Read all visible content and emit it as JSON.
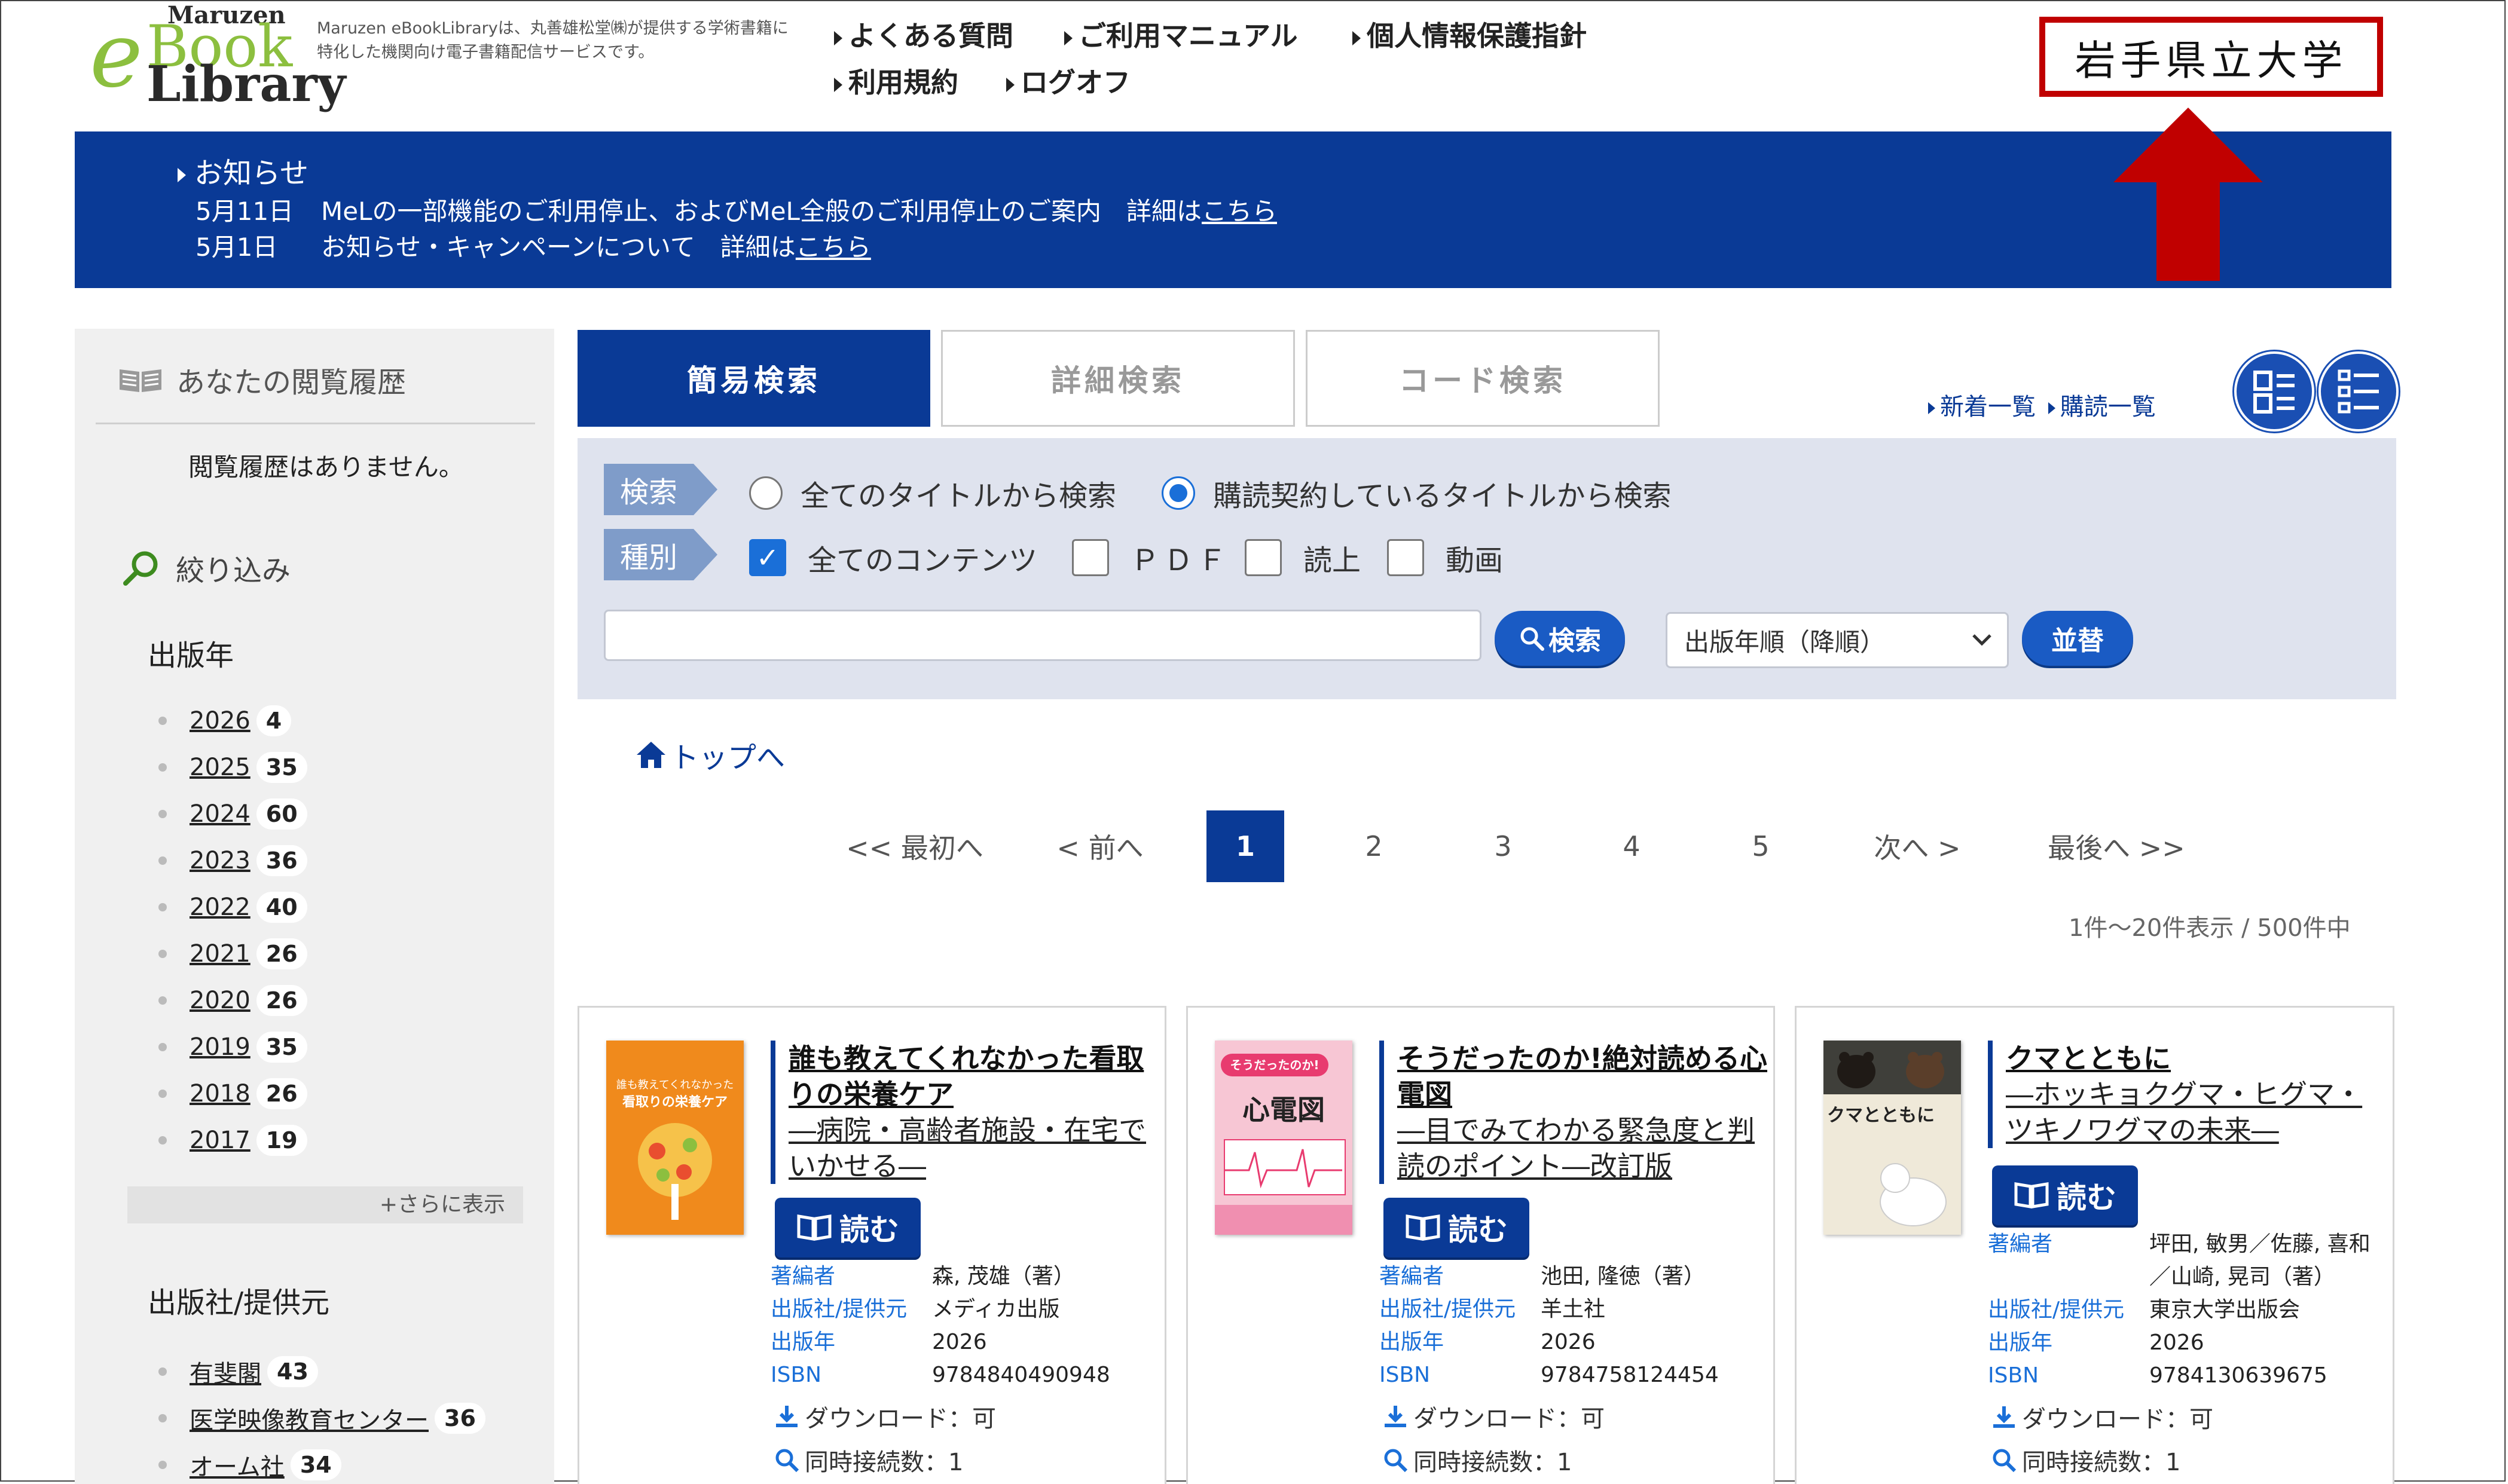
{
  "header": {
    "logo_maruzen": "Maruzen",
    "logo_e": "e",
    "logo_book": "Book",
    "logo_library": "Library",
    "tagline": "Maruzen eBookLibraryは、丸善雄松堂㈱が提供する学術書籍に特化した機関向け電子書籍配信サービスです。",
    "nav": [
      "よくある質問",
      "ご利用マニュアル",
      "個人情報保護指針",
      "利用規約",
      "ログオフ"
    ],
    "university": "岩手県立大学"
  },
  "notice": {
    "heading": "お知らせ",
    "items": [
      {
        "date": "5月11日",
        "text": "MeLの一部機能のご利用停止、およびMeL全般のご利用停止のご案内　詳細は",
        "link": "こちら"
      },
      {
        "date": "5月1日",
        "text": "お知らせ・キャンペーンについて　詳細は",
        "link": "こちら"
      }
    ]
  },
  "sidebar": {
    "history_title": "あなたの閲覧履歴",
    "history_empty": "閲覧履歴はありません。",
    "refine_title": "絞り込み",
    "year_title": "出版年",
    "years": [
      {
        "year": "2026",
        "count": "4"
      },
      {
        "year": "2025",
        "count": "35"
      },
      {
        "year": "2024",
        "count": "60"
      },
      {
        "year": "2023",
        "count": "36"
      },
      {
        "year": "2022",
        "count": "40"
      },
      {
        "year": "2021",
        "count": "26"
      },
      {
        "year": "2020",
        "count": "26"
      },
      {
        "year": "2019",
        "count": "35"
      },
      {
        "year": "2018",
        "count": "26"
      },
      {
        "year": "2017",
        "count": "19"
      }
    ],
    "more": "+さらに表示",
    "publisher_title": "出版社/提供元",
    "publishers": [
      {
        "name": "有斐閣",
        "count": "43"
      },
      {
        "name": "医学映像教育センター",
        "count": "36"
      },
      {
        "name": "オーム社",
        "count": "34"
      }
    ]
  },
  "tabs": [
    "簡易検索",
    "詳細検索",
    "コード検索"
  ],
  "links_right": [
    "新着一覧",
    "購読一覧"
  ],
  "search": {
    "scope_label": "検索",
    "scope_options": [
      "全てのタイトルから検索",
      "購読契約しているタイトルから検索"
    ],
    "scope_selected": 1,
    "type_label": "種別",
    "type_options": [
      {
        "label": "全てのコンテンツ",
        "checked": true
      },
      {
        "label": "ＰＤＦ",
        "checked": false
      },
      {
        "label": "読上",
        "checked": false
      },
      {
        "label": "動画",
        "checked": false
      }
    ],
    "input_value": "",
    "search_button": "検索",
    "sort_selected": "出版年順（降順）",
    "sort_button": "並替"
  },
  "breadcrumb_top": "トップへ",
  "pagination": {
    "first": "<< 最初へ",
    "prev": "< 前へ",
    "pages": [
      "1",
      "2",
      "3",
      "4",
      "5"
    ],
    "current": "1",
    "next": "次へ >",
    "last": "最後へ >>"
  },
  "result_count": "1件～20件表示 / 500件中",
  "books": [
    {
      "title": "誰も教えてくれなかった看取りの栄養ケア",
      "subtitle": "―病院・高齢者施設・在宅でいかせる―",
      "read": "読む",
      "author_label": "著編者",
      "author": "森, 茂雄（著）",
      "publisher_label": "出版社/提供元",
      "publisher": "メディカ出版",
      "year_label": "出版年",
      "year": "2026",
      "isbn_label": "ISBN",
      "isbn": "9784840490948",
      "download": "ダウンロード：可",
      "concurrent": "同時接続数：1",
      "cover_top": "誰も教えてくれなかった",
      "cover_title": "看取りの栄養ケア",
      "cover_color": "#f08a1c"
    },
    {
      "title": "そうだったのか!絶対読める心電図",
      "subtitle": "―目でみてわかる緊急度と判読のポイント―改訂版",
      "read": "読む",
      "author_label": "著編者",
      "author": "池田, 隆徳（著）",
      "publisher_label": "出版社/提供元",
      "publisher": "羊土社",
      "year_label": "出版年",
      "year": "2026",
      "isbn_label": "ISBN",
      "isbn": "9784758124454",
      "download": "ダウンロード：可",
      "concurrent": "同時接続数：1",
      "cover_top": "そうだったのか!",
      "cover_title": "心電図",
      "cover_color": "#f7c6d4"
    },
    {
      "title": "クマとともに",
      "subtitle": "―ホッキョクグマ・ヒグマ・ツキノワグマの未来―",
      "read": "読む",
      "author_label": "著編者",
      "author": "坪田, 敏男／佐藤, 喜和／山崎, 晃司（著）",
      "publisher_label": "出版社/提供元",
      "publisher": "東京大学出版会",
      "year_label": "出版年",
      "year": "2026",
      "isbn_label": "ISBN",
      "isbn": "9784130639675",
      "download": "ダウンロード：可",
      "concurrent": "同時接続数：1",
      "cover_top": "",
      "cover_title": "クマとともに",
      "cover_color": "#e8e2d2"
    }
  ]
}
